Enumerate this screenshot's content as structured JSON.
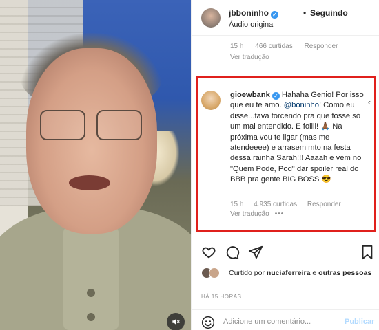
{
  "post": {
    "username": "jbboninho",
    "separator": "•",
    "follow_state": "Seguindo",
    "audio": "Áudio original"
  },
  "previous_comment": {
    "time": "15 h",
    "likes": "466 curtidas",
    "reply": "Responder",
    "translate": "Ver tradução"
  },
  "highlight_comment": {
    "username": "gioewbank",
    "line1": "Hahaha Genio! Por",
    "line2": "isso que eu te amo.",
    "mention": "@boninho",
    "line2b": "!",
    "line3": "Como eu disse...tava torcendo pra",
    "line4": "que fosse só um mal entendido. E",
    "line5a": "foiiii!",
    "emoji1": "🙏🏾",
    "line5b": "Na próxima vou te ligar",
    "line6": "(mas me atendeeee) e arrasem mto",
    "line7": "na festa dessa rainha Sarah!!! Aaaah",
    "line8": "e vem no \"Quem Pode, Pod\" dar",
    "line9": "spoiler real do BBB pra gente BIG",
    "line10": "BOSS",
    "emoji2": "😎",
    "time": "15 h",
    "likes": "4.935 curtidas",
    "reply": "Responder",
    "translate": "Ver tradução",
    "more": "•••",
    "side_more": "‹"
  },
  "likes_summary": {
    "prefix": "Curtido por ",
    "user": "nuciaferreira",
    "middle": " e ",
    "others": "outras pessoas"
  },
  "time_ago": "HÁ 15 HORAS",
  "composer": {
    "placeholder": "Adicione um comentário...",
    "publish": "Publicar"
  },
  "colors": {
    "highlight": "#e0201c",
    "verified": "#3897f0",
    "muted": "#8e8e8e",
    "publish": "#b3dbff"
  }
}
